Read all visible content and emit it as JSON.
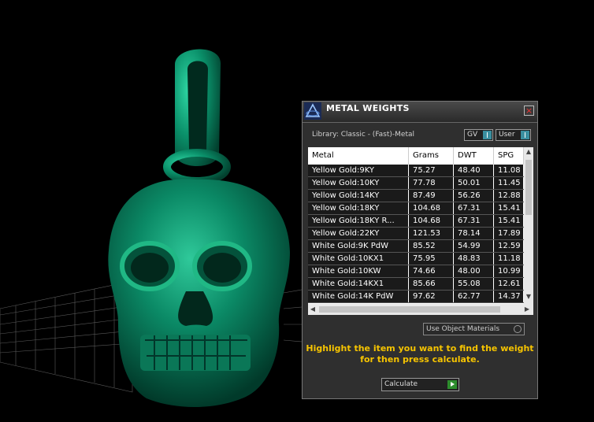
{
  "window": {
    "title": "METAL WEIGHTS",
    "close_glyph": "×",
    "library_label": "Library: Classic - (Fast)-Metal",
    "toggles": [
      "GV",
      "User"
    ],
    "accent_color": "#3a8fa0"
  },
  "table": {
    "columns": [
      "Metal",
      "Grams",
      "DWT",
      "SPG"
    ],
    "rows": [
      {
        "metal": "Yellow Gold:9KY",
        "grams": "75.27",
        "dwt": "48.40",
        "spg": "11.08"
      },
      {
        "metal": "Yellow Gold:10KY",
        "grams": "77.78",
        "dwt": "50.01",
        "spg": "11.45"
      },
      {
        "metal": "Yellow Gold:14KY",
        "grams": "87.49",
        "dwt": "56.26",
        "spg": "12.88"
      },
      {
        "metal": "Yellow Gold:18KY",
        "grams": "104.68",
        "dwt": "67.31",
        "spg": "15.41"
      },
      {
        "metal": "Yellow Gold:18KY R...",
        "grams": "104.68",
        "dwt": "67.31",
        "spg": "15.41"
      },
      {
        "metal": "Yellow Gold:22KY",
        "grams": "121.53",
        "dwt": "78.14",
        "spg": "17.89"
      },
      {
        "metal": "White Gold:9K PdW",
        "grams": "85.52",
        "dwt": "54.99",
        "spg": "12.59"
      },
      {
        "metal": "White Gold:10KX1",
        "grams": "75.95",
        "dwt": "48.83",
        "spg": "11.18"
      },
      {
        "metal": "White Gold:10KW",
        "grams": "74.66",
        "dwt": "48.00",
        "spg": "10.99"
      },
      {
        "metal": "White Gold:14KX1",
        "grams": "85.66",
        "dwt": "55.08",
        "spg": "12.61"
      },
      {
        "metal": "White Gold:14K PdW",
        "grams": "97.62",
        "dwt": "62.77",
        "spg": "14.37"
      }
    ]
  },
  "options": {
    "use_object_materials": "Use Object Materials"
  },
  "hint": {
    "line1": "Highlight the item you want to find the weight",
    "line2": "for then press calculate."
  },
  "calculate": {
    "label": "Calculate"
  },
  "scene": {
    "model": "skull-pendant",
    "model_color": "#0b8a66"
  }
}
